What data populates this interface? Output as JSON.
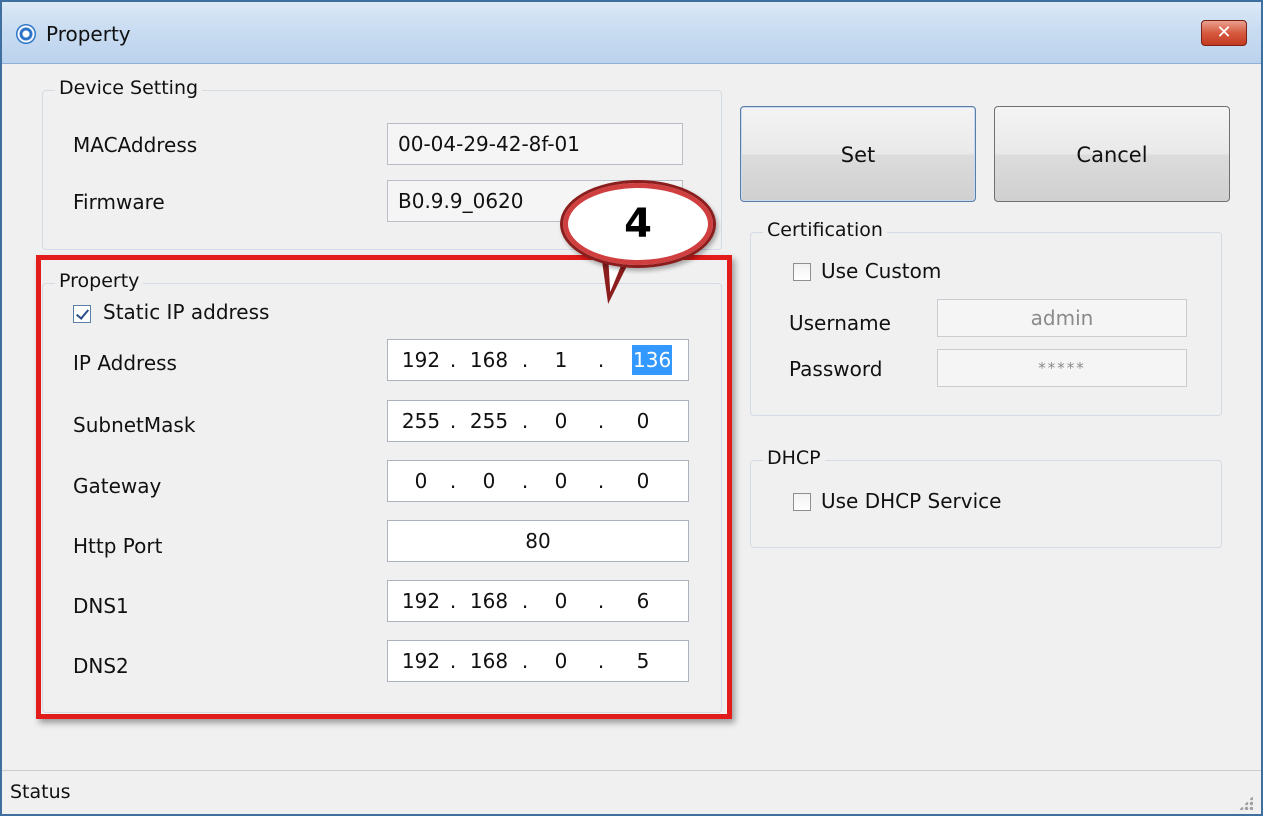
{
  "window": {
    "title": "Property",
    "close_glyph": "✕",
    "icon": "app-icon"
  },
  "device_setting": {
    "title": "Device Setting",
    "mac_label": "MACAddress",
    "mac_value": "00-04-29-42-8f-01",
    "firmware_label": "Firmware",
    "firmware_value": "B0.9.9_0620"
  },
  "property": {
    "title": "Property",
    "static_ip_label": "Static IP address",
    "static_ip_checked": true,
    "ip_label": "IP Address",
    "ip": [
      "192",
      "168",
      "1",
      "136"
    ],
    "subnet_label": "SubnetMask",
    "subnet": [
      "255",
      "255",
      "0",
      "0"
    ],
    "gateway_label": "Gateway",
    "gateway": [
      "0",
      "0",
      "0",
      "0"
    ],
    "http_port_label": "Http Port",
    "http_port": "80",
    "dns1_label": "DNS1",
    "dns1": [
      "192",
      "168",
      "0",
      "6"
    ],
    "dns2_label": "DNS2",
    "dns2": [
      "192",
      "168",
      "0",
      "5"
    ]
  },
  "buttons": {
    "set": "Set",
    "cancel": "Cancel"
  },
  "certification": {
    "title": "Certification",
    "use_custom_label": "Use Custom",
    "use_custom_checked": false,
    "username_label": "Username",
    "username_value": "admin",
    "password_label": "Password",
    "password_value": "*****"
  },
  "dhcp": {
    "title": "DHCP",
    "use_dhcp_label": "Use DHCP Service",
    "use_dhcp_checked": false
  },
  "annotation": {
    "callout_number": "4",
    "highlight_color": "#e21b1b"
  },
  "status": {
    "text": "Status"
  }
}
